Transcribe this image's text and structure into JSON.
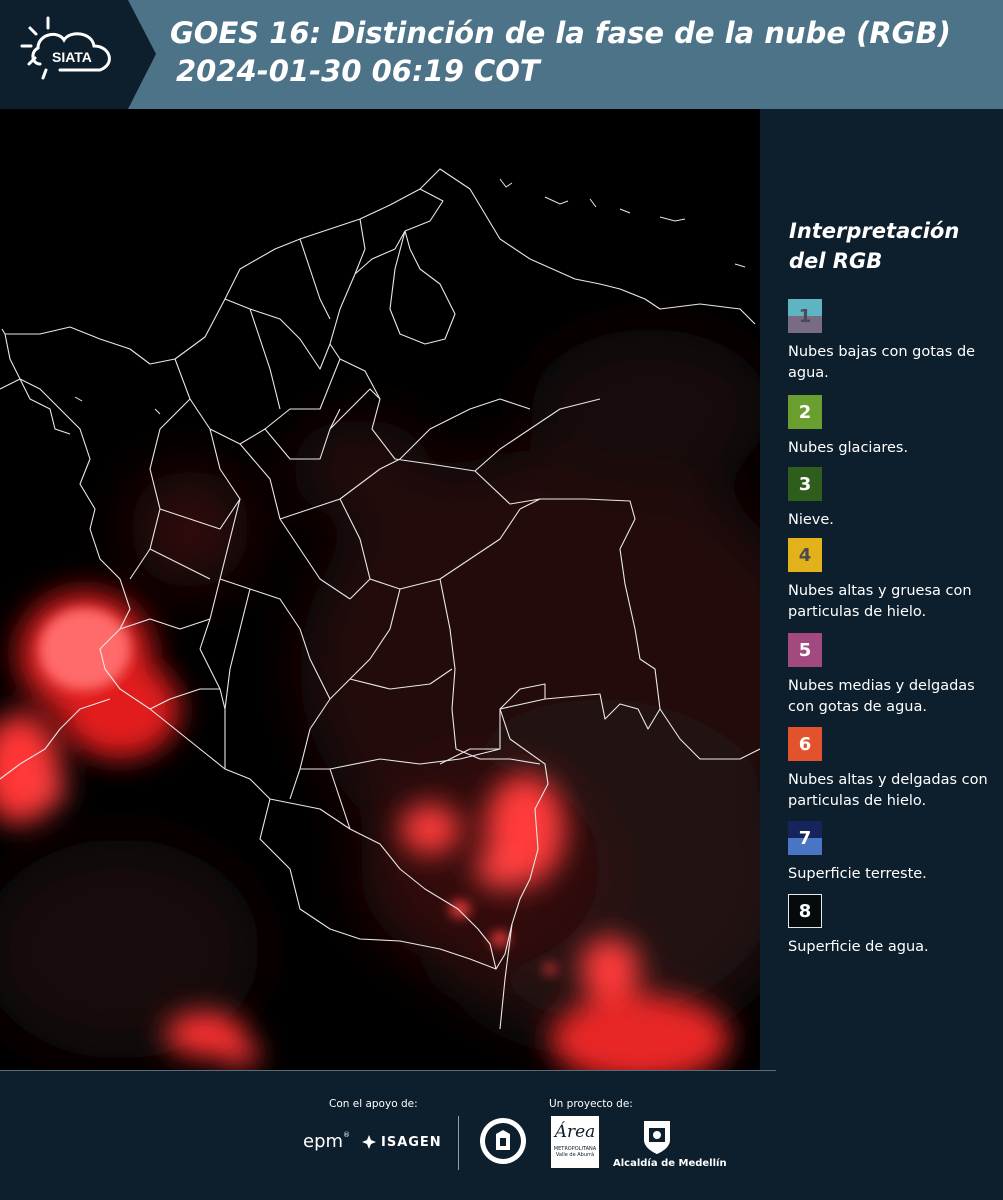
{
  "header": {
    "logo_text": "SIATA",
    "title_line1": "GOES 16: Distinción de la fase de la nube (RGB)",
    "title_line2": "2024-01-30 06:19 COT",
    "bg_color": "#4d7388"
  },
  "legend": {
    "title": "Interpretación del RGB",
    "items": [
      {
        "number": "1",
        "label": "Nubes bajas con gotas de agua.",
        "color_top": "#5fb4c1",
        "color_bottom": "#7a6b85",
        "text_color": "#4a4a55"
      },
      {
        "number": "2",
        "label": "Nubes glaciares.",
        "color_top": "#6a9e2f",
        "color_bottom": "#6a9e2f",
        "text_color": "#ffffff"
      },
      {
        "number": "3",
        "label": "Nieve.",
        "color_top": "#2f5e1c",
        "color_bottom": "#2f5e1c",
        "text_color": "#ffffff"
      },
      {
        "number": "4",
        "label": "Nubes altas y gruesa con particulas de hielo.",
        "color_top": "#e3b21b",
        "color_bottom": "#e3b21b",
        "text_color": "#4a4a55"
      },
      {
        "number": "5",
        "label": "Nubes medias y delgadas con gotas de agua.",
        "color_top": "#a24a80",
        "color_bottom": "#a24a80",
        "text_color": "#ffffff"
      },
      {
        "number": "6",
        "label": "Nubes altas y delgadas con particulas de hielo.",
        "color_top": "#e2522c",
        "color_bottom": "#e2522c",
        "text_color": "#ffffff"
      },
      {
        "number": "7",
        "label": "Superficie terreste.",
        "color_top": "#16245e",
        "color_bottom": "#4a74c4",
        "text_color": "#ffffff"
      },
      {
        "number": "8",
        "label": "Superficie de agua.",
        "color_top": "#050b0d",
        "color_bottom": "#050b0d",
        "text_color": "#ffffff"
      }
    ]
  },
  "footer": {
    "support_label": "Con el apoyo de:",
    "project_label": "Un proyecto de:",
    "sponsor_epm": "epm",
    "sponsor_isagen": "ISAGEN",
    "sponsor_area": "Área",
    "sponsor_area_sub": "METROPOLITANA\nValle de Aburrá",
    "sponsor_alcaldia": "Alcaldía de Medellín"
  }
}
